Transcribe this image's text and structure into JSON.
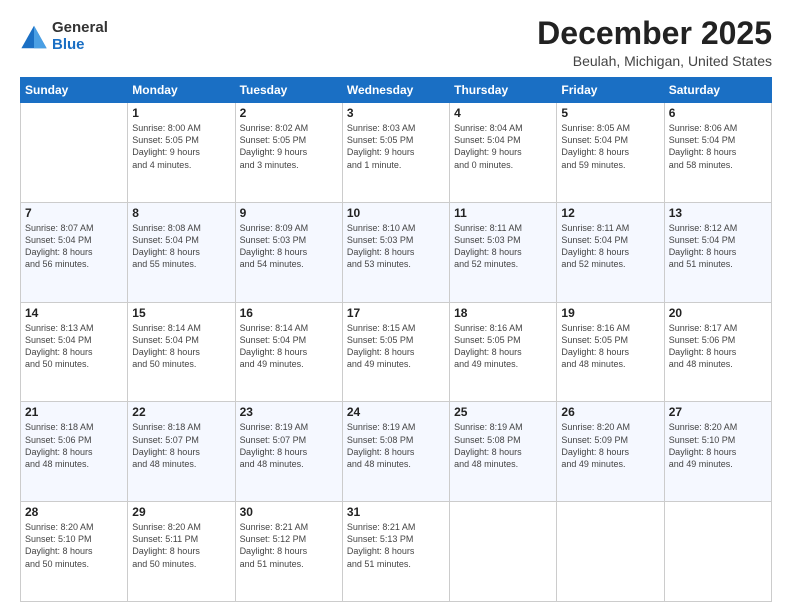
{
  "header": {
    "logo_general": "General",
    "logo_blue": "Blue",
    "month_title": "December 2025",
    "location": "Beulah, Michigan, United States"
  },
  "weekdays": [
    "Sunday",
    "Monday",
    "Tuesday",
    "Wednesday",
    "Thursday",
    "Friday",
    "Saturday"
  ],
  "weeks": [
    [
      {
        "day": "",
        "content": ""
      },
      {
        "day": "1",
        "content": "Sunrise: 8:00 AM\nSunset: 5:05 PM\nDaylight: 9 hours\nand 4 minutes."
      },
      {
        "day": "2",
        "content": "Sunrise: 8:02 AM\nSunset: 5:05 PM\nDaylight: 9 hours\nand 3 minutes."
      },
      {
        "day": "3",
        "content": "Sunrise: 8:03 AM\nSunset: 5:05 PM\nDaylight: 9 hours\nand 1 minute."
      },
      {
        "day": "4",
        "content": "Sunrise: 8:04 AM\nSunset: 5:04 PM\nDaylight: 9 hours\nand 0 minutes."
      },
      {
        "day": "5",
        "content": "Sunrise: 8:05 AM\nSunset: 5:04 PM\nDaylight: 8 hours\nand 59 minutes."
      },
      {
        "day": "6",
        "content": "Sunrise: 8:06 AM\nSunset: 5:04 PM\nDaylight: 8 hours\nand 58 minutes."
      }
    ],
    [
      {
        "day": "7",
        "content": "Sunrise: 8:07 AM\nSunset: 5:04 PM\nDaylight: 8 hours\nand 56 minutes."
      },
      {
        "day": "8",
        "content": "Sunrise: 8:08 AM\nSunset: 5:04 PM\nDaylight: 8 hours\nand 55 minutes."
      },
      {
        "day": "9",
        "content": "Sunrise: 8:09 AM\nSunset: 5:03 PM\nDaylight: 8 hours\nand 54 minutes."
      },
      {
        "day": "10",
        "content": "Sunrise: 8:10 AM\nSunset: 5:03 PM\nDaylight: 8 hours\nand 53 minutes."
      },
      {
        "day": "11",
        "content": "Sunrise: 8:11 AM\nSunset: 5:03 PM\nDaylight: 8 hours\nand 52 minutes."
      },
      {
        "day": "12",
        "content": "Sunrise: 8:11 AM\nSunset: 5:04 PM\nDaylight: 8 hours\nand 52 minutes."
      },
      {
        "day": "13",
        "content": "Sunrise: 8:12 AM\nSunset: 5:04 PM\nDaylight: 8 hours\nand 51 minutes."
      }
    ],
    [
      {
        "day": "14",
        "content": "Sunrise: 8:13 AM\nSunset: 5:04 PM\nDaylight: 8 hours\nand 50 minutes."
      },
      {
        "day": "15",
        "content": "Sunrise: 8:14 AM\nSunset: 5:04 PM\nDaylight: 8 hours\nand 50 minutes."
      },
      {
        "day": "16",
        "content": "Sunrise: 8:14 AM\nSunset: 5:04 PM\nDaylight: 8 hours\nand 49 minutes."
      },
      {
        "day": "17",
        "content": "Sunrise: 8:15 AM\nSunset: 5:05 PM\nDaylight: 8 hours\nand 49 minutes."
      },
      {
        "day": "18",
        "content": "Sunrise: 8:16 AM\nSunset: 5:05 PM\nDaylight: 8 hours\nand 49 minutes."
      },
      {
        "day": "19",
        "content": "Sunrise: 8:16 AM\nSunset: 5:05 PM\nDaylight: 8 hours\nand 48 minutes."
      },
      {
        "day": "20",
        "content": "Sunrise: 8:17 AM\nSunset: 5:06 PM\nDaylight: 8 hours\nand 48 minutes."
      }
    ],
    [
      {
        "day": "21",
        "content": "Sunrise: 8:18 AM\nSunset: 5:06 PM\nDaylight: 8 hours\nand 48 minutes."
      },
      {
        "day": "22",
        "content": "Sunrise: 8:18 AM\nSunset: 5:07 PM\nDaylight: 8 hours\nand 48 minutes."
      },
      {
        "day": "23",
        "content": "Sunrise: 8:19 AM\nSunset: 5:07 PM\nDaylight: 8 hours\nand 48 minutes."
      },
      {
        "day": "24",
        "content": "Sunrise: 8:19 AM\nSunset: 5:08 PM\nDaylight: 8 hours\nand 48 minutes."
      },
      {
        "day": "25",
        "content": "Sunrise: 8:19 AM\nSunset: 5:08 PM\nDaylight: 8 hours\nand 48 minutes."
      },
      {
        "day": "26",
        "content": "Sunrise: 8:20 AM\nSunset: 5:09 PM\nDaylight: 8 hours\nand 49 minutes."
      },
      {
        "day": "27",
        "content": "Sunrise: 8:20 AM\nSunset: 5:10 PM\nDaylight: 8 hours\nand 49 minutes."
      }
    ],
    [
      {
        "day": "28",
        "content": "Sunrise: 8:20 AM\nSunset: 5:10 PM\nDaylight: 8 hours\nand 50 minutes."
      },
      {
        "day": "29",
        "content": "Sunrise: 8:20 AM\nSunset: 5:11 PM\nDaylight: 8 hours\nand 50 minutes."
      },
      {
        "day": "30",
        "content": "Sunrise: 8:21 AM\nSunset: 5:12 PM\nDaylight: 8 hours\nand 51 minutes."
      },
      {
        "day": "31",
        "content": "Sunrise: 8:21 AM\nSunset: 5:13 PM\nDaylight: 8 hours\nand 51 minutes."
      },
      {
        "day": "",
        "content": ""
      },
      {
        "day": "",
        "content": ""
      },
      {
        "day": "",
        "content": ""
      }
    ]
  ]
}
